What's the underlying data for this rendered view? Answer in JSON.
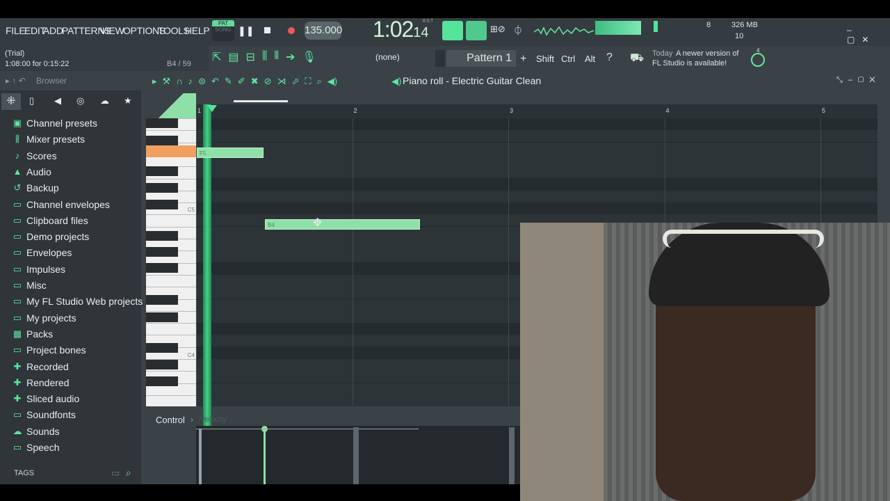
{
  "menu": {
    "items": [
      "FILE",
      "EDIT",
      "ADD",
      "PATTERNS",
      "VIEW",
      "OPTIONS",
      "TOOLS",
      "HELP"
    ]
  },
  "transport": {
    "mode_pat": "PAT",
    "mode_song": "SONG",
    "tempo": "135.000",
    "time_main": "1:02",
    "time_sub": "14",
    "time_label": "B:S:T"
  },
  "status": {
    "trial": "(Trial)",
    "time_left": "1:08:00 for 0:15:22",
    "note_pos": "B4 / 59"
  },
  "toolbar": {
    "none_select": "(none)",
    "pattern": "Pattern 1",
    "shift": "Shift",
    "ctrl": "Ctrl",
    "alt": "Alt",
    "update_today": "Today",
    "update_msg_1": "A newer version of",
    "update_msg_2": "FL Studio is available!",
    "update_count": "4"
  },
  "meters": {
    "cpu": "8",
    "ram": "326 MB",
    "poly": "10"
  },
  "browser": {
    "title": "Browser",
    "items": [
      {
        "label": "Channel presets",
        "icon": "preset-icon"
      },
      {
        "label": "Mixer presets",
        "icon": "mixer-icon"
      },
      {
        "label": "Scores",
        "icon": "note-icon"
      },
      {
        "label": "Audio",
        "icon": "audio-icon"
      },
      {
        "label": "Backup",
        "icon": "backup-folder-icon"
      },
      {
        "label": "Channel envelopes",
        "icon": "folder-icon"
      },
      {
        "label": "Clipboard files",
        "icon": "folder-icon"
      },
      {
        "label": "Demo projects",
        "icon": "folder-icon"
      },
      {
        "label": "Envelopes",
        "icon": "folder-icon"
      },
      {
        "label": "Impulses",
        "icon": "folder-icon"
      },
      {
        "label": "Misc",
        "icon": "folder-icon"
      },
      {
        "label": "My FL Studio Web projects",
        "icon": "folder-icon"
      },
      {
        "label": "My projects",
        "icon": "folder-icon"
      },
      {
        "label": "Packs",
        "icon": "packs-icon"
      },
      {
        "label": "Project bones",
        "icon": "folder-icon"
      },
      {
        "label": "Recorded",
        "icon": "recorded-icon"
      },
      {
        "label": "Rendered",
        "icon": "rendered-icon"
      },
      {
        "label": "Sliced audio",
        "icon": "sliced-audio-icon"
      },
      {
        "label": "Soundfonts",
        "icon": "folder-icon"
      },
      {
        "label": "Sounds",
        "icon": "cloud-icon"
      },
      {
        "label": "Speech",
        "icon": "folder-icon"
      }
    ],
    "tags": "TAGS"
  },
  "piano_roll": {
    "title": "Piano roll - Electric Guitar Clean",
    "bars": [
      "1",
      "2",
      "3",
      "4",
      "5"
    ],
    "key_labels": [
      "C5",
      "C4"
    ],
    "notes": [
      {
        "label": "F5"
      },
      {
        "label": "B4"
      }
    ],
    "control_label": "Control",
    "control_sub": "Velocity"
  }
}
